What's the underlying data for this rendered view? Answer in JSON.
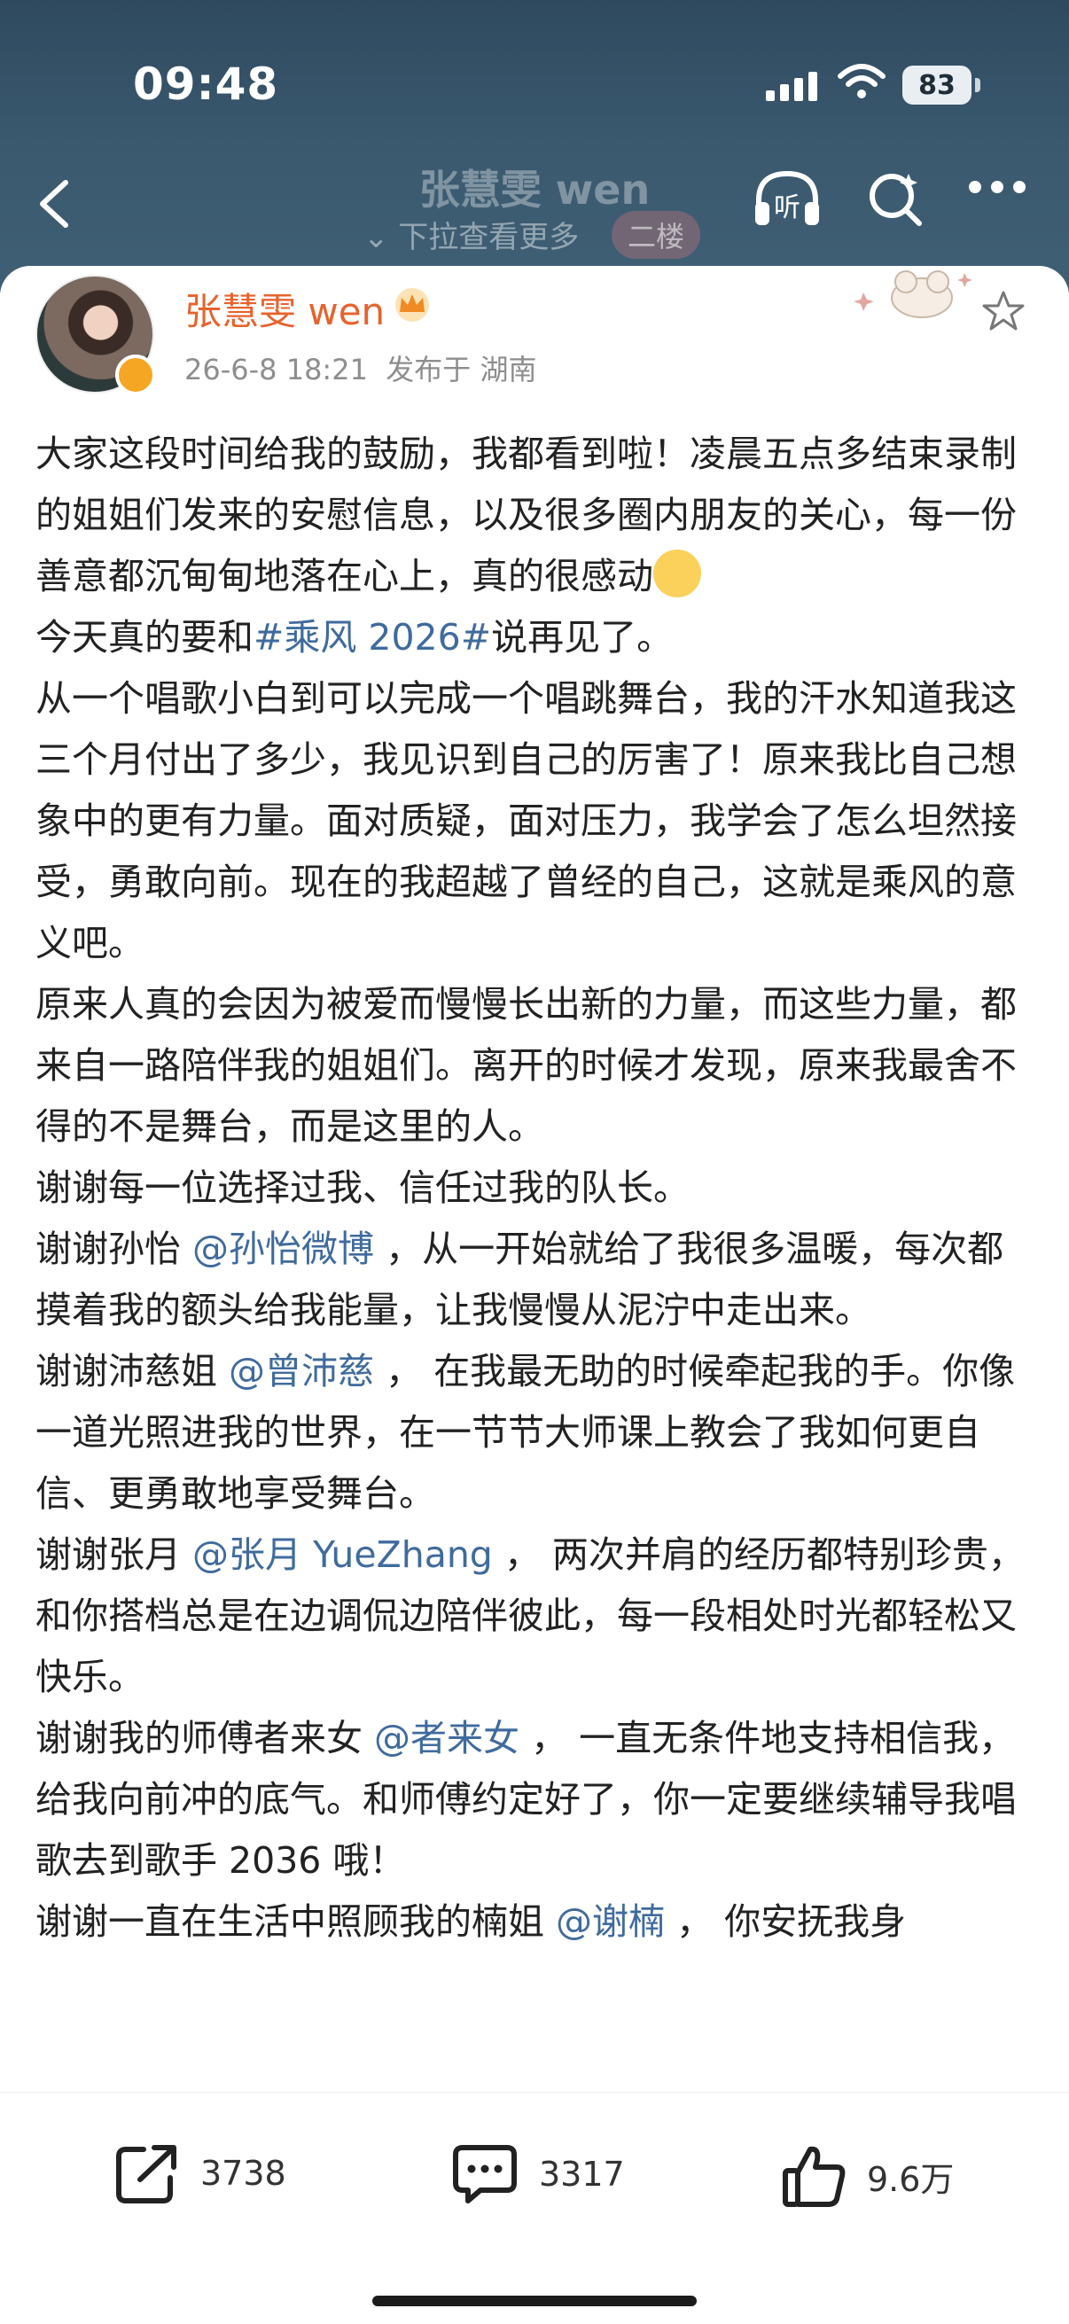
{
  "status": {
    "time": "09:48",
    "battery": "83"
  },
  "nav": {
    "title": "张慧雯 wen",
    "pull_hint": "下拉查看更多",
    "floor_badge": "二楼"
  },
  "post": {
    "author": "张慧雯 wen",
    "date": "26-6-8 18:21",
    "location": "发布于 湖南",
    "p1": "大家这段时间给我的鼓励，我都看到啦！凌晨五点多结束录制的姐姐们发来的安慰信息，以及很多圈内朋友的关心，每一份善意都沉甸甸地落在心上，真的很感动",
    "p2a": "今天真的要和",
    "hashtag": "#乘风 2026#",
    "p2b": "说再见了。",
    "p3": "从一个唱歌小白到可以完成一个唱跳舞台，我的汗水知道我这三个月付出了多少，我见识到自己的厉害了！原来我比自己想象中的更有力量。面对质疑，面对压力，我学会了怎么坦然接受，勇敢向前。现在的我超越了曾经的自己，这就是乘风的意义吧。",
    "p4": "原来人真的会因为被爱而慢慢长出新的力量，而这些力量，都来自一路陪伴我的姐姐们。离开的时候才发现，原来我最舍不得的不是舞台，而是这里的人。",
    "p5": "谢谢每一位选择过我、信任过我的队长。",
    "p6a": "谢谢孙怡 ",
    "m1": "@孙怡微博",
    "p6b": " ，从一开始就给了我很多温暖，每次都摸着我的额头给我能量，让我慢慢从泥泞中走出来。",
    "p7a": "谢谢沛慈姐 ",
    "m2": "@曾沛慈",
    "p7b": " ， 在我最无助的时候牵起我的手。你像一道光照进我的世界，在一节节大师课上教会了我如何更自信、更勇敢地享受舞台。",
    "p8a": "谢谢张月 ",
    "m3": "@张月 YueZhang",
    "p8b": " ， 两次并肩的经历都特别珍贵，和你搭档总是在边调侃边陪伴彼此，每一段相处时光都轻松又快乐。",
    "p9a": "谢谢我的师傅者来女 ",
    "m4": "@者来女",
    "p9b": " ， 一直无条件地支持相信我，给我向前冲的底气。和师傅约定好了，你一定要继续辅导我唱歌去到歌手 2036 哦！",
    "p10a": "谢谢一直在生活中照顾我的楠姐 ",
    "m5": "@谢楠",
    "p10b": " ， 你安抚我身"
  },
  "actions": {
    "share": "3738",
    "comment": "3317",
    "like": "9.6万"
  }
}
